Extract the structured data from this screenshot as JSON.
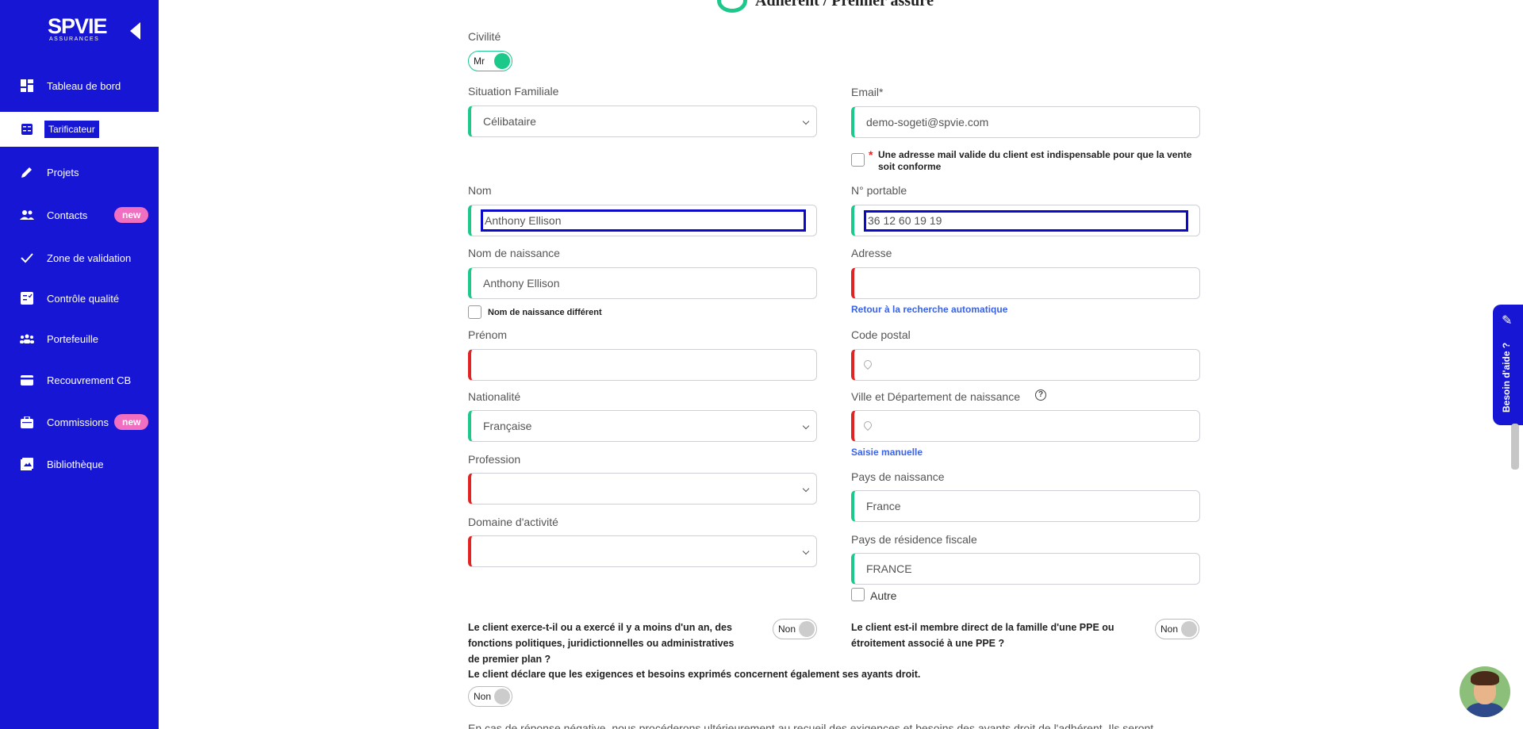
{
  "sidebar": {
    "logo_main": "SPVIE",
    "logo_sub": "ASSURANCES",
    "items": [
      {
        "label": "Tableau de bord",
        "icon": "dashboard-icon"
      },
      {
        "label": "Tarificateur",
        "icon": "calculator-icon",
        "active": true
      },
      {
        "label": "Projets",
        "icon": "pencil-icon"
      },
      {
        "label": "Contacts",
        "icon": "people-icon",
        "badge": "new"
      },
      {
        "label": "Zone de validation",
        "icon": "check-icon"
      },
      {
        "label": "Contrôle qualité",
        "icon": "checklist-icon"
      },
      {
        "label": "Portefeuille",
        "icon": "group-icon"
      },
      {
        "label": "Recouvrement CB",
        "icon": "credit-card-icon"
      },
      {
        "label": "Commissions",
        "icon": "briefcase-icon",
        "badge": "new"
      },
      {
        "label": "Bibliothèque",
        "icon": "images-icon"
      }
    ]
  },
  "header": {
    "title": "Adhérent / Premier assuré"
  },
  "form": {
    "civilite": {
      "label": "Civilité",
      "value": "Mr"
    },
    "situation": {
      "label": "Situation Familiale",
      "value": "Célibataire"
    },
    "email": {
      "label": "Email*",
      "value": "demo-sogeti@spvie.com",
      "notice": "Une adresse mail valide du client est indispensable pour que la vente soit conforme",
      "asterisk": "*"
    },
    "nom": {
      "label": "Nom",
      "value": "Anthony Ellison"
    },
    "portable": {
      "label": "N° portable",
      "value": "36 12 60 19 19"
    },
    "nom_naissance": {
      "label": "Nom de naissance",
      "value": "Anthony Ellison",
      "checkbox_label": "Nom de naissance différent"
    },
    "adresse": {
      "label": "Adresse",
      "value": "",
      "link": "Retour à la recherche automatique"
    },
    "prenom": {
      "label": "Prénom",
      "value": ""
    },
    "code_postal": {
      "label": "Code postal",
      "value": ""
    },
    "nationalite": {
      "label": "Nationalité",
      "value": "Française"
    },
    "ville_naissance": {
      "label": "Ville et Département de naissance",
      "value": "",
      "link": "Saisie manuelle"
    },
    "profession": {
      "label": "Profession",
      "value": ""
    },
    "pays_naissance": {
      "label": "Pays de naissance",
      "value": "France"
    },
    "domaine": {
      "label": "Domaine d'activité",
      "value": ""
    },
    "pays_fiscal": {
      "label": "Pays de résidence fiscale",
      "value": "FRANCE",
      "checkbox_label": "Autre"
    }
  },
  "questions": {
    "q1": {
      "text": "Le client exerce-t-il ou a exercé il y a moins d'un an, des fonctions politiques, juridictionnelles ou administratives de premier plan ?",
      "value": "Non"
    },
    "q2": {
      "text": "Le client est-il membre direct de la famille d'une PPE ou étroitement associé à une PPE ?",
      "value": "Non"
    },
    "q3": {
      "text": "Le client déclare que les exigences et besoins exprimés concernent également ses ayants droit.",
      "value": "Non"
    },
    "footer": "En cas de réponse négative, nous procéderons ultérieurement au recueil des exigences et besoins des ayants droit de l'adhérent. Ils seront"
  },
  "help": {
    "label": "Besoin d'aide ?"
  },
  "colors": {
    "sidebar": "#1616d4",
    "valid": "#1cc88a",
    "invalid": "#e02424",
    "badge": "#f06fc0",
    "link": "#3a62e8"
  }
}
